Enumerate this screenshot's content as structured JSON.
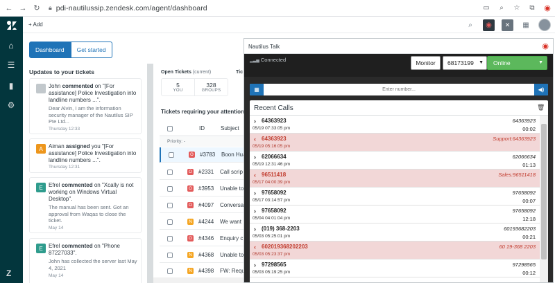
{
  "browser": {
    "url": "pdi-nautilussip.zendesk.com/agent/dashboard"
  },
  "topbar": {
    "add_label": "+ Add"
  },
  "dashboard": {
    "tabs": [
      {
        "label": "Dashboard",
        "active": true
      },
      {
        "label": "Get started",
        "active": false
      }
    ]
  },
  "updates": {
    "title": "Updates to your tickets",
    "items": [
      {
        "initial": "",
        "name": "John",
        "action": "commented",
        "rest": " on \"[For assistance] Police Investigation into landline numbers ...\".",
        "snippet": "Dear Alvin, I am the information security manager of the Nautilus SIP Pte Ltd...",
        "time": "Thursday 12:33"
      },
      {
        "initial": "A",
        "name": "Aiman",
        "action": "assigned",
        "rest": " you \"[For assistance] Police Investigation into landline numbers ...\".",
        "snippet": "",
        "time": "Thursday 12:31"
      },
      {
        "initial": "E",
        "name": "Efrel",
        "action": "commented",
        "rest": " on \"Xcally is not working on Windows Virtual Desktop\".",
        "snippet": "The manual has been sent. Got an approval from Waqas to close the ticket.",
        "time": "May 14"
      },
      {
        "initial": "E",
        "name": "Efrel",
        "action": "commented",
        "rest": " on \"Phone 87227033\".",
        "snippet": "John has collected the server last May 4, 2021",
        "time": "May 14"
      }
    ]
  },
  "open_tickets": {
    "title": "Open Tickets",
    "qualifier": "(current)",
    "cards": [
      {
        "count": "5",
        "label": "YOU"
      },
      {
        "count": "328",
        "label": "GROUPS"
      }
    ],
    "next_title_cut": "Tic"
  },
  "tickets": {
    "title": "Tickets requiring your attention",
    "columns": {
      "id": "ID",
      "subject": "Subject"
    },
    "priority_label": "Priority: -",
    "rows": [
      {
        "status": "O",
        "id": "#3783",
        "subject": "Boon Hua",
        "selected": true
      },
      {
        "status": "O",
        "id": "#2331",
        "subject": "Call scrip",
        "selected": false
      },
      {
        "status": "O",
        "id": "#3953",
        "subject": "Unable to",
        "selected": false
      },
      {
        "status": "O",
        "id": "#4097",
        "subject": "Conversa",
        "selected": false
      },
      {
        "status": "N",
        "id": "#4244",
        "subject": "We want",
        "selected": false
      },
      {
        "status": "O",
        "id": "#4346",
        "subject": "Enquiry c",
        "selected": false
      },
      {
        "status": "N",
        "id": "#4368",
        "subject": "Unable to",
        "selected": false
      },
      {
        "status": "N",
        "id": "#4398",
        "subject": "FW: Requ",
        "selected": false
      }
    ]
  },
  "nautilus": {
    "title": "Nautilus Talk",
    "status": "Connected",
    "monitor_label": "Monitor",
    "extension": "68173199",
    "presence": "Online",
    "dial_placeholder": "Enter number...",
    "recent_title": "Recent Calls",
    "calls": [
      {
        "type": "outgoing",
        "number": "64363923",
        "date": "05/19 07:33:05 pm",
        "right": "64363923",
        "duration": "00:02"
      },
      {
        "type": "missed",
        "number": "64363923",
        "date": "05/19 05:16:05 pm",
        "right": "Support:64363923",
        "duration": ""
      },
      {
        "type": "outgoing",
        "number": "62066634",
        "date": "05/19 12:31:46 pm",
        "right": "62066634",
        "duration": "01:13"
      },
      {
        "type": "missed",
        "number": "96511418",
        "date": "05/17 04:00:39 pm",
        "right": "Sales:96511418",
        "duration": ""
      },
      {
        "type": "outgoing",
        "number": "97658092",
        "date": "05/17 03:14:57 pm",
        "right": "97658092",
        "duration": "00:07"
      },
      {
        "type": "outgoing",
        "number": "97658092",
        "date": "05/04 04:01:04 pm",
        "right": "97658092",
        "duration": "12:18"
      },
      {
        "type": "outgoing",
        "number": "(019) 368-2203",
        "date": "05/03 05:25:01 pm",
        "right": "60193682203",
        "duration": "00:21"
      },
      {
        "type": "missed",
        "number": "602019368202203",
        "date": "05/03 05:23:37 pm",
        "right": "60 19-368 2203",
        "duration": ""
      },
      {
        "type": "outgoing",
        "number": "97298565",
        "date": "05/03 05:19:25 pm",
        "right": "97298565",
        "duration": "00:12"
      }
    ]
  }
}
